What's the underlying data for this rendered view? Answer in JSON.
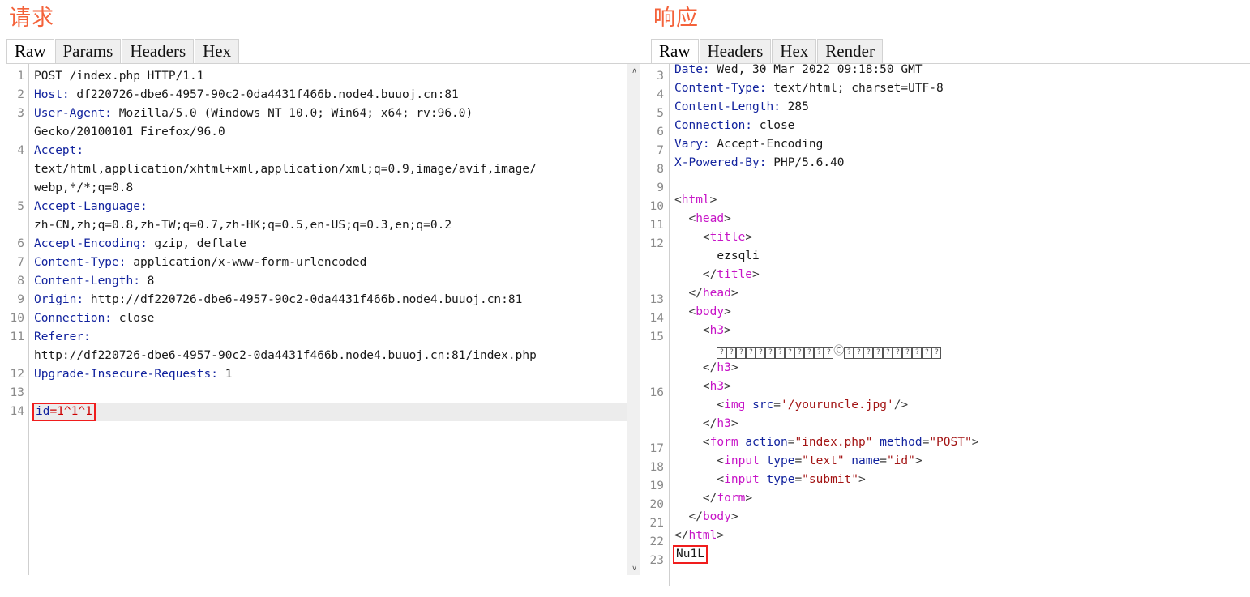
{
  "request": {
    "title": "请求",
    "tabs": [
      {
        "label": "Raw",
        "active": true
      },
      {
        "label": "Params",
        "active": false
      },
      {
        "label": "Headers",
        "active": false
      },
      {
        "label": "Hex",
        "active": false
      }
    ],
    "line_numbers": [
      "1",
      "2",
      "3",
      "",
      "4",
      "",
      "",
      "5",
      "",
      "6",
      "7",
      "8",
      "9",
      "10",
      "11",
      "",
      "12",
      "13",
      "14"
    ],
    "lines": [
      {
        "n": "1",
        "type": "plain",
        "text": "POST /index.php HTTP/1.1"
      },
      {
        "n": "2",
        "type": "header",
        "name": "Host:",
        "value": " df220726-dbe6-4957-90c2-0da4431f466b.node4.buuoj.cn:81"
      },
      {
        "n": "3",
        "type": "header",
        "name": "User-Agent:",
        "value": " Mozilla/5.0 (Windows NT 10.0; Win64; x64; rv:96.0)"
      },
      {
        "n": "",
        "type": "cont",
        "text": "Gecko/20100101 Firefox/96.0"
      },
      {
        "n": "4",
        "type": "header",
        "name": "Accept:",
        "value": ""
      },
      {
        "n": "",
        "type": "cont",
        "text": "text/html,application/xhtml+xml,application/xml;q=0.9,image/avif,image/"
      },
      {
        "n": "",
        "type": "cont",
        "text": "webp,*/*;q=0.8"
      },
      {
        "n": "5",
        "type": "header",
        "name": "Accept-Language:",
        "value": ""
      },
      {
        "n": "",
        "type": "cont",
        "text": "zh-CN,zh;q=0.8,zh-TW;q=0.7,zh-HK;q=0.5,en-US;q=0.3,en;q=0.2"
      },
      {
        "n": "6",
        "type": "header",
        "name": "Accept-Encoding:",
        "value": " gzip, deflate"
      },
      {
        "n": "7",
        "type": "header",
        "name": "Content-Type:",
        "value": " application/x-www-form-urlencoded"
      },
      {
        "n": "8",
        "type": "header",
        "name": "Content-Length:",
        "value": " 8"
      },
      {
        "n": "9",
        "type": "header",
        "name": "Origin:",
        "value": " http://df220726-dbe6-4957-90c2-0da4431f466b.node4.buuoj.cn:81"
      },
      {
        "n": "10",
        "type": "header",
        "name": "Connection:",
        "value": " close"
      },
      {
        "n": "11",
        "type": "header",
        "name": "Referer:",
        "value": ""
      },
      {
        "n": "",
        "type": "cont",
        "text": "http://df220726-dbe6-4957-90c2-0da4431f466b.node4.buuoj.cn:81/index.php"
      },
      {
        "n": "12",
        "type": "header",
        "name": "Upgrade-Insecure-Requests:",
        "value": " 1"
      },
      {
        "n": "13",
        "type": "blank",
        "text": ""
      },
      {
        "n": "14",
        "type": "payload",
        "key": "id",
        "value": "=1^1^1",
        "highlighted": true,
        "boxed": true
      }
    ],
    "payload_box_color": "#f01d1d",
    "scrollbar": {
      "up_arrow": "∧",
      "down_arrow": "∨"
    }
  },
  "response": {
    "title": "响应",
    "tabs": [
      {
        "label": "Raw",
        "active": true
      },
      {
        "label": "Headers",
        "active": false
      },
      {
        "label": "Hex",
        "active": false
      },
      {
        "label": "Render",
        "active": false
      }
    ],
    "lines": [
      {
        "n": "3",
        "type": "header",
        "name": "Date:",
        "value": " Wed, 30 Mar 2022 09:18:50 GMT",
        "clipped": true
      },
      {
        "n": "4",
        "type": "header",
        "name": "Content-Type:",
        "value": " text/html; charset=UTF-8"
      },
      {
        "n": "5",
        "type": "header",
        "name": "Content-Length:",
        "value": " 285"
      },
      {
        "n": "6",
        "type": "header",
        "name": "Connection:",
        "value": " close"
      },
      {
        "n": "7",
        "type": "header",
        "name": "Vary:",
        "value": " Accept-Encoding"
      },
      {
        "n": "8",
        "type": "header",
        "name": "X-Powered-By:",
        "value": " PHP/5.6.40"
      },
      {
        "n": "9",
        "type": "blank",
        "text": ""
      },
      {
        "n": "10",
        "type": "tag",
        "indent": 0,
        "text": "<html>"
      },
      {
        "n": "11",
        "type": "tag",
        "indent": 1,
        "text": "<head>"
      },
      {
        "n": "12",
        "type": "tag",
        "indent": 2,
        "text": "<title>"
      },
      {
        "n": "",
        "type": "content",
        "indent": 3,
        "text": "ezsqli"
      },
      {
        "n": "",
        "type": "tag",
        "indent": 2,
        "text": "</title>"
      },
      {
        "n": "13",
        "type": "tag",
        "indent": 1,
        "text": "</head>"
      },
      {
        "n": "14",
        "type": "tag",
        "indent": 1,
        "text": "<body>"
      },
      {
        "n": "15",
        "type": "tag",
        "indent": 2,
        "text": "<h3>"
      },
      {
        "n": "",
        "type": "tofu",
        "indent": 3,
        "before": 12,
        "circled": "Ⓒ",
        "after": 10
      },
      {
        "n": "",
        "type": "tag",
        "indent": 2,
        "text": "</h3>"
      },
      {
        "n": "16",
        "type": "tag",
        "indent": 2,
        "text": "<h3>"
      },
      {
        "n": "",
        "type": "imgtag",
        "indent": 3,
        "tagname": "img",
        "attr": "src",
        "value": "'/youruncle.jpg'",
        "close": "/>"
      },
      {
        "n": "",
        "type": "tag",
        "indent": 2,
        "text": "</h3>"
      },
      {
        "n": "17",
        "type": "formtag",
        "indent": 2,
        "tagname": "form",
        "attrs": [
          {
            "name": "action",
            "value": "\"index.php\""
          },
          {
            "name": "method",
            "value": "\"POST\""
          }
        ],
        "close": ">"
      },
      {
        "n": "18",
        "type": "formtag",
        "indent": 3,
        "tagname": "input",
        "attrs": [
          {
            "name": "type",
            "value": "\"text\""
          },
          {
            "name": "name",
            "value": "\"id\""
          }
        ],
        "close": ">"
      },
      {
        "n": "19",
        "type": "formtag",
        "indent": 3,
        "tagname": "input",
        "attrs": [
          {
            "name": "type",
            "value": "\"submit\""
          }
        ],
        "close": ">"
      },
      {
        "n": "20",
        "type": "tag",
        "indent": 2,
        "text": "</form>"
      },
      {
        "n": "21",
        "type": "tag",
        "indent": 1,
        "text": "</body>"
      },
      {
        "n": "22",
        "type": "tag",
        "indent": 0,
        "text": "</html>"
      },
      {
        "n": "23",
        "type": "flag",
        "indent": 0,
        "text": "Nu1L",
        "boxed": true
      }
    ],
    "flag_box_color": "#f01d1d"
  },
  "colors": {
    "title": "#f4623a",
    "header_name": "#12239e",
    "tag_name": "#c715c7",
    "attr_name": "#12239e",
    "attr_value": "#a31515",
    "payload_value": "#cc0000",
    "highlight_box": "#f01d1d",
    "highlight_row": "#ececec"
  }
}
